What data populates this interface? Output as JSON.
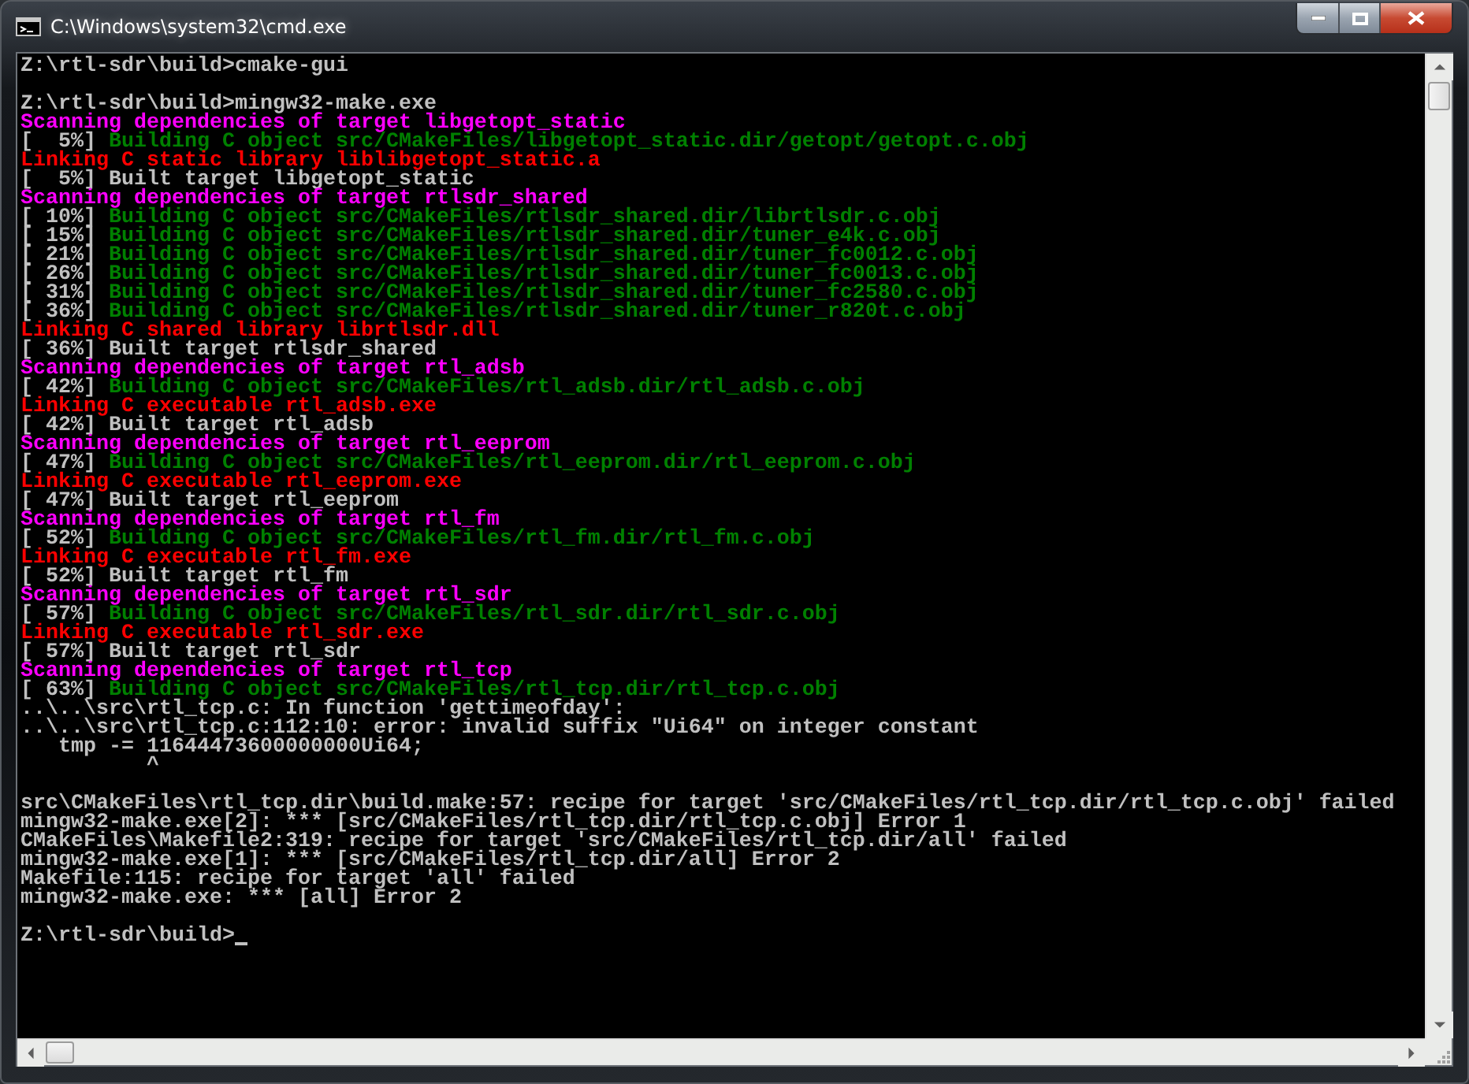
{
  "window": {
    "title": "C:\\Windows\\system32\\cmd.exe"
  },
  "console": {
    "lines": [
      {
        "kind": "text",
        "segments": [
          {
            "text": "Z:\\rtl-sdr\\build>cmake-gui",
            "color": "#c0c0c0"
          }
        ]
      },
      {
        "kind": "blank"
      },
      {
        "kind": "text",
        "segments": [
          {
            "text": "Z:\\rtl-sdr\\build>mingw32-make.exe",
            "color": "#c0c0c0"
          }
        ]
      },
      {
        "kind": "text",
        "segments": [
          {
            "text": "Scanning dependencies of target libgetopt_static",
            "color": "#ff00ff"
          }
        ]
      },
      {
        "kind": "text",
        "segments": [
          {
            "text": "[  5%] ",
            "color": "#c0c0c0"
          },
          {
            "text": "Building C object src/CMakeFiles/libgetopt_static.dir/getopt/getopt.c.obj",
            "color": "#008000"
          }
        ]
      },
      {
        "kind": "text",
        "segments": [
          {
            "text": "Linking C static library liblibgetopt_static.a",
            "color": "#ff0000"
          }
        ]
      },
      {
        "kind": "text",
        "segments": [
          {
            "text": "[  5%] Built target libgetopt_static",
            "color": "#c0c0c0"
          }
        ]
      },
      {
        "kind": "text",
        "segments": [
          {
            "text": "Scanning dependencies of target rtlsdr_shared",
            "color": "#ff00ff"
          }
        ]
      },
      {
        "kind": "text",
        "segments": [
          {
            "text": "[ 10%] ",
            "color": "#c0c0c0"
          },
          {
            "text": "Building C object src/CMakeFiles/rtlsdr_shared.dir/librtlsdr.c.obj",
            "color": "#008000"
          }
        ]
      },
      {
        "kind": "text",
        "segments": [
          {
            "text": "[ 15%] ",
            "color": "#c0c0c0"
          },
          {
            "text": "Building C object src/CMakeFiles/rtlsdr_shared.dir/tuner_e4k.c.obj",
            "color": "#008000"
          }
        ]
      },
      {
        "kind": "text",
        "segments": [
          {
            "text": "[ 21%] ",
            "color": "#c0c0c0"
          },
          {
            "text": "Building C object src/CMakeFiles/rtlsdr_shared.dir/tuner_fc0012.c.obj",
            "color": "#008000"
          }
        ]
      },
      {
        "kind": "text",
        "segments": [
          {
            "text": "[ 26%] ",
            "color": "#c0c0c0"
          },
          {
            "text": "Building C object src/CMakeFiles/rtlsdr_shared.dir/tuner_fc0013.c.obj",
            "color": "#008000"
          }
        ]
      },
      {
        "kind": "text",
        "segments": [
          {
            "text": "[ 31%] ",
            "color": "#c0c0c0"
          },
          {
            "text": "Building C object src/CMakeFiles/rtlsdr_shared.dir/tuner_fc2580.c.obj",
            "color": "#008000"
          }
        ]
      },
      {
        "kind": "text",
        "segments": [
          {
            "text": "[ 36%] ",
            "color": "#c0c0c0"
          },
          {
            "text": "Building C object src/CMakeFiles/rtlsdr_shared.dir/tuner_r820t.c.obj",
            "color": "#008000"
          }
        ]
      },
      {
        "kind": "text",
        "segments": [
          {
            "text": "Linking C shared library librtlsdr.dll",
            "color": "#ff0000"
          }
        ]
      },
      {
        "kind": "text",
        "segments": [
          {
            "text": "[ 36%] Built target rtlsdr_shared",
            "color": "#c0c0c0"
          }
        ]
      },
      {
        "kind": "text",
        "segments": [
          {
            "text": "Scanning dependencies of target rtl_adsb",
            "color": "#ff00ff"
          }
        ]
      },
      {
        "kind": "text",
        "segments": [
          {
            "text": "[ 42%] ",
            "color": "#c0c0c0"
          },
          {
            "text": "Building C object src/CMakeFiles/rtl_adsb.dir/rtl_adsb.c.obj",
            "color": "#008000"
          }
        ]
      },
      {
        "kind": "text",
        "segments": [
          {
            "text": "Linking C executable rtl_adsb.exe",
            "color": "#ff0000"
          }
        ]
      },
      {
        "kind": "text",
        "segments": [
          {
            "text": "[ 42%] Built target rtl_adsb",
            "color": "#c0c0c0"
          }
        ]
      },
      {
        "kind": "text",
        "segments": [
          {
            "text": "Scanning dependencies of target rtl_eeprom",
            "color": "#ff00ff"
          }
        ]
      },
      {
        "kind": "text",
        "segments": [
          {
            "text": "[ 47%] ",
            "color": "#c0c0c0"
          },
          {
            "text": "Building C object src/CMakeFiles/rtl_eeprom.dir/rtl_eeprom.c.obj",
            "color": "#008000"
          }
        ]
      },
      {
        "kind": "text",
        "segments": [
          {
            "text": "Linking C executable rtl_eeprom.exe",
            "color": "#ff0000"
          }
        ]
      },
      {
        "kind": "text",
        "segments": [
          {
            "text": "[ 47%] Built target rtl_eeprom",
            "color": "#c0c0c0"
          }
        ]
      },
      {
        "kind": "text",
        "segments": [
          {
            "text": "Scanning dependencies of target rtl_fm",
            "color": "#ff00ff"
          }
        ]
      },
      {
        "kind": "text",
        "segments": [
          {
            "text": "[ 52%] ",
            "color": "#c0c0c0"
          },
          {
            "text": "Building C object src/CMakeFiles/rtl_fm.dir/rtl_fm.c.obj",
            "color": "#008000"
          }
        ]
      },
      {
        "kind": "text",
        "segments": [
          {
            "text": "Linking C executable rtl_fm.exe",
            "color": "#ff0000"
          }
        ]
      },
      {
        "kind": "text",
        "segments": [
          {
            "text": "[ 52%] Built target rtl_fm",
            "color": "#c0c0c0"
          }
        ]
      },
      {
        "kind": "text",
        "segments": [
          {
            "text": "Scanning dependencies of target rtl_sdr",
            "color": "#ff00ff"
          }
        ]
      },
      {
        "kind": "text",
        "segments": [
          {
            "text": "[ 57%] ",
            "color": "#c0c0c0"
          },
          {
            "text": "Building C object src/CMakeFiles/rtl_sdr.dir/rtl_sdr.c.obj",
            "color": "#008000"
          }
        ]
      },
      {
        "kind": "text",
        "segments": [
          {
            "text": "Linking C executable rtl_sdr.exe",
            "color": "#ff0000"
          }
        ]
      },
      {
        "kind": "text",
        "segments": [
          {
            "text": "[ 57%] Built target rtl_sdr",
            "color": "#c0c0c0"
          }
        ]
      },
      {
        "kind": "text",
        "segments": [
          {
            "text": "Scanning dependencies of target rtl_tcp",
            "color": "#ff00ff"
          }
        ]
      },
      {
        "kind": "text",
        "segments": [
          {
            "text": "[ 63%] ",
            "color": "#c0c0c0"
          },
          {
            "text": "Building C object src/CMakeFiles/rtl_tcp.dir/rtl_tcp.c.obj",
            "color": "#008000"
          }
        ]
      },
      {
        "kind": "text",
        "segments": [
          {
            "text": "..\\..\\src\\rtl_tcp.c: In function 'gettimeofday':",
            "color": "#c0c0c0"
          }
        ]
      },
      {
        "kind": "text",
        "segments": [
          {
            "text": "..\\..\\src\\rtl_tcp.c:112:10: error: invalid suffix \"Ui64\" on integer constant",
            "color": "#c0c0c0"
          }
        ]
      },
      {
        "kind": "text",
        "segments": [
          {
            "text": "   tmp -= 11644473600000000Ui64;",
            "color": "#c0c0c0"
          }
        ]
      },
      {
        "kind": "text",
        "segments": [
          {
            "text": "          ^",
            "color": "#c0c0c0"
          }
        ]
      },
      {
        "kind": "blank"
      },
      {
        "kind": "text",
        "segments": [
          {
            "text": "src\\CMakeFiles\\rtl_tcp.dir\\build.make:57: recipe for target 'src/CMakeFiles/rtl_tcp.dir/rtl_tcp.c.obj' failed",
            "color": "#c0c0c0"
          }
        ]
      },
      {
        "kind": "text",
        "segments": [
          {
            "text": "mingw32-make.exe[2]: *** [src/CMakeFiles/rtl_tcp.dir/rtl_tcp.c.obj] Error 1",
            "color": "#c0c0c0"
          }
        ]
      },
      {
        "kind": "text",
        "segments": [
          {
            "text": "CMakeFiles\\Makefile2:319: recipe for target 'src/CMakeFiles/rtl_tcp.dir/all' failed",
            "color": "#c0c0c0"
          }
        ]
      },
      {
        "kind": "text",
        "segments": [
          {
            "text": "mingw32-make.exe[1]: *** [src/CMakeFiles/rtl_tcp.dir/all] Error 2",
            "color": "#c0c0c0"
          }
        ]
      },
      {
        "kind": "text",
        "segments": [
          {
            "text": "Makefile:115: recipe for target 'all' failed",
            "color": "#c0c0c0"
          }
        ]
      },
      {
        "kind": "text",
        "segments": [
          {
            "text": "mingw32-make.exe: *** [all] Error 2",
            "color": "#c0c0c0"
          }
        ]
      },
      {
        "kind": "blank"
      },
      {
        "kind": "prompt",
        "segments": [
          {
            "text": "Z:\\rtl-sdr\\build>",
            "color": "#c0c0c0"
          }
        ]
      }
    ]
  }
}
